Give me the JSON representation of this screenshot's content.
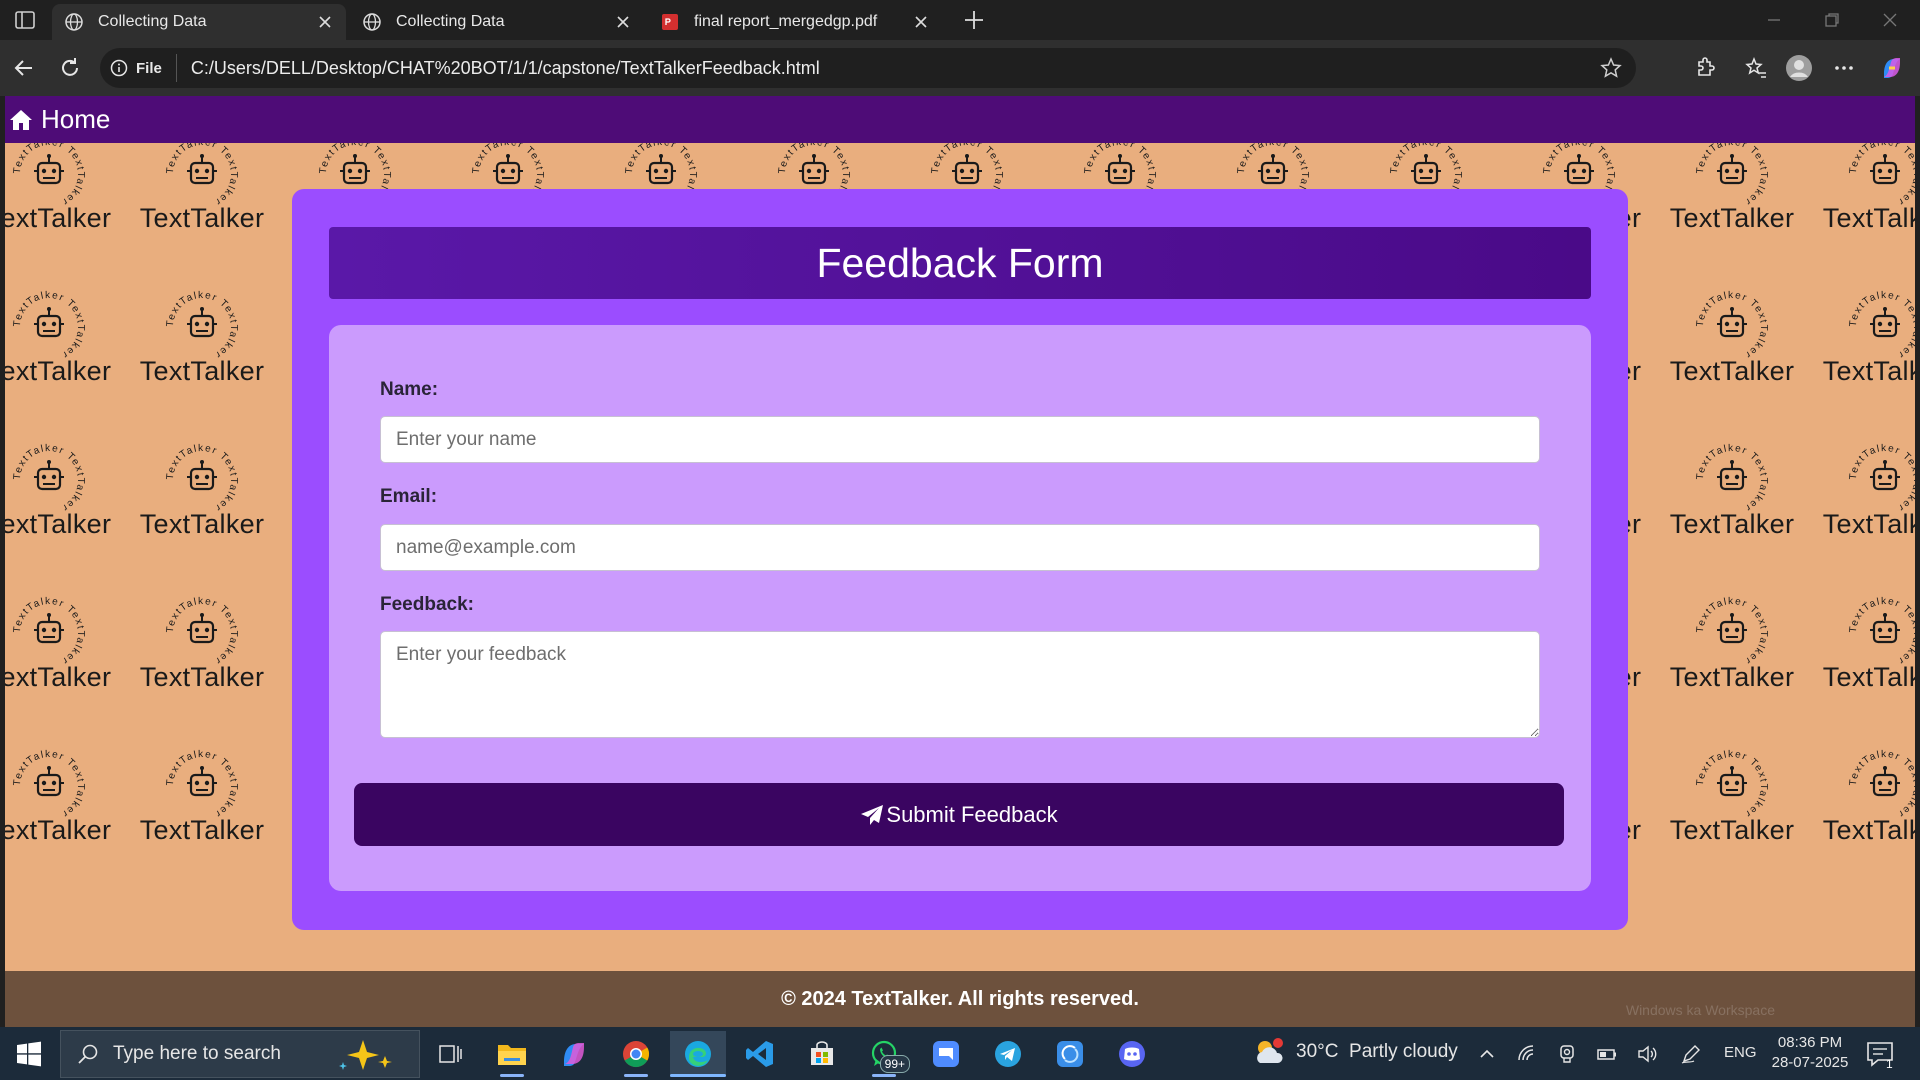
{
  "browser": {
    "tabs": [
      {
        "title": "Collecting Data",
        "icon": "globe-icon"
      },
      {
        "title": "Collecting Data",
        "icon": "globe-icon"
      },
      {
        "title": "final report_mergedgp.pdf",
        "icon": "pdf-icon"
      }
    ],
    "address": {
      "chip": "File",
      "url": "C:/Users/DELL/Desktop/CHAT%20BOT/1/1/capstone/TextTalkerFeedback.html"
    }
  },
  "page": {
    "nav": {
      "home_label": "Home"
    },
    "background": {
      "brand_text": "TextTalker",
      "badge_ring_text": "TextTalker"
    },
    "form": {
      "title": "Feedback Form",
      "name_label": "Name:",
      "name_placeholder": "Enter your name",
      "email_label": "Email:",
      "email_placeholder": "name@example.com",
      "feedback_label": "Feedback:",
      "feedback_placeholder": "Enter your feedback",
      "submit_label": "Submit Feedback"
    },
    "footer": "© 2024 TextTalker. All rights reserved.",
    "watermark": "Windows ka Workspace"
  },
  "taskbar": {
    "search_placeholder": "Type here to search",
    "whatsapp_badge": "99+",
    "weather": {
      "temp": "30°C",
      "condition": "Partly cloudy",
      "alert_count": "1"
    },
    "language": "ENG",
    "time": "08:36 PM",
    "date": "28-07-2025",
    "notification_count": "1"
  },
  "colors": {
    "nav_bg": "#4e0c77",
    "page_bg": "#e9ae7e",
    "card_bg": "#9b4dff",
    "panel_bg": "#cb9bfd",
    "button_bg": "#3a0561"
  }
}
